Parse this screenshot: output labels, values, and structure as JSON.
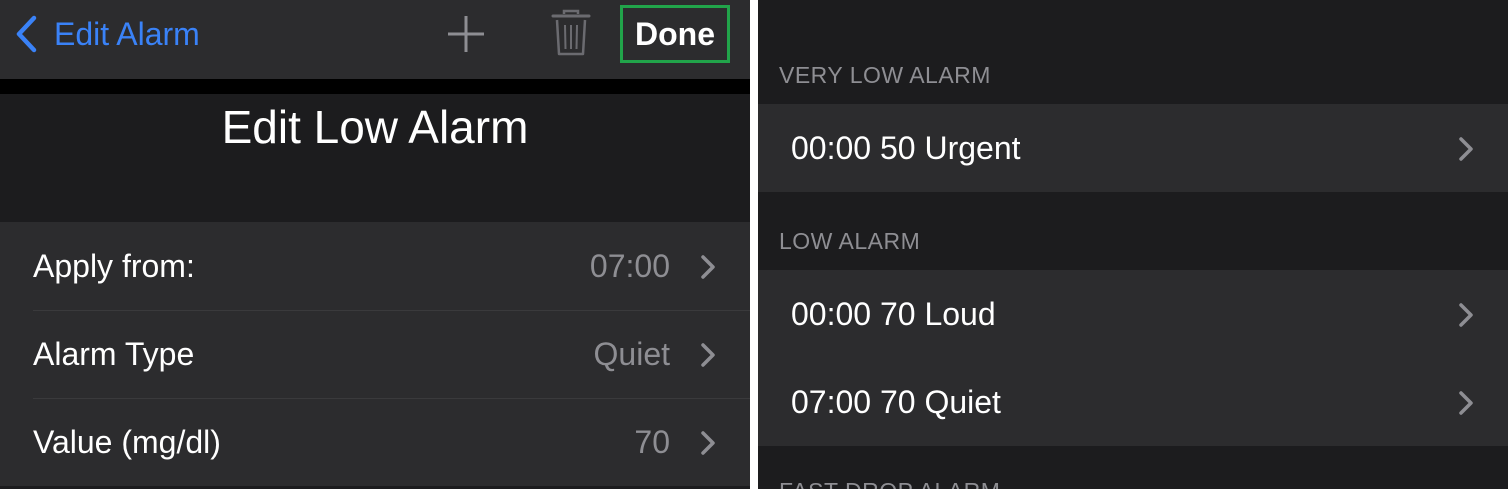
{
  "left": {
    "nav": {
      "back_label": "Edit Alarm",
      "add_icon": "plus-icon",
      "delete_icon": "trash-icon",
      "done_label": "Done",
      "done_highlight_color": "#21a44a"
    },
    "title": "Edit Low Alarm",
    "rows": [
      {
        "label": "Apply from:",
        "value": "07:00"
      },
      {
        "label": "Alarm Type",
        "value": "Quiet"
      },
      {
        "label": "Value (mg/dl)",
        "value": "70"
      }
    ]
  },
  "right": {
    "sections": [
      {
        "header": "VERY LOW ALARM",
        "items": [
          "00:00 50 Urgent"
        ]
      },
      {
        "header": "LOW ALARM",
        "items": [
          "00:00 70 Loud",
          "07:00 70 Quiet"
        ]
      },
      {
        "header": "FAST DROP ALARM",
        "items": []
      }
    ]
  },
  "colors": {
    "background": "#1c1c1e",
    "cell": "#2c2c2e",
    "accent": "#3a82f7",
    "secondary_text": "#8e8e93"
  }
}
